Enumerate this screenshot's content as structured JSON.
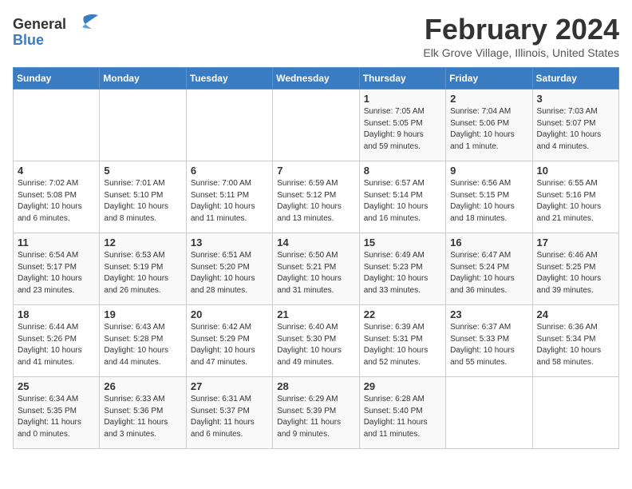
{
  "logo": {
    "general": "General",
    "blue": "Blue"
  },
  "title": "February 2024",
  "subtitle": "Elk Grove Village, Illinois, United States",
  "days_of_week": [
    "Sunday",
    "Monday",
    "Tuesday",
    "Wednesday",
    "Thursday",
    "Friday",
    "Saturday"
  ],
  "weeks": [
    [
      {
        "day": "",
        "info": ""
      },
      {
        "day": "",
        "info": ""
      },
      {
        "day": "",
        "info": ""
      },
      {
        "day": "",
        "info": ""
      },
      {
        "day": "1",
        "info": "Sunrise: 7:05 AM\nSunset: 5:05 PM\nDaylight: 9 hours\nand 59 minutes."
      },
      {
        "day": "2",
        "info": "Sunrise: 7:04 AM\nSunset: 5:06 PM\nDaylight: 10 hours\nand 1 minute."
      },
      {
        "day": "3",
        "info": "Sunrise: 7:03 AM\nSunset: 5:07 PM\nDaylight: 10 hours\nand 4 minutes."
      }
    ],
    [
      {
        "day": "4",
        "info": "Sunrise: 7:02 AM\nSunset: 5:08 PM\nDaylight: 10 hours\nand 6 minutes."
      },
      {
        "day": "5",
        "info": "Sunrise: 7:01 AM\nSunset: 5:10 PM\nDaylight: 10 hours\nand 8 minutes."
      },
      {
        "day": "6",
        "info": "Sunrise: 7:00 AM\nSunset: 5:11 PM\nDaylight: 10 hours\nand 11 minutes."
      },
      {
        "day": "7",
        "info": "Sunrise: 6:59 AM\nSunset: 5:12 PM\nDaylight: 10 hours\nand 13 minutes."
      },
      {
        "day": "8",
        "info": "Sunrise: 6:57 AM\nSunset: 5:14 PM\nDaylight: 10 hours\nand 16 minutes."
      },
      {
        "day": "9",
        "info": "Sunrise: 6:56 AM\nSunset: 5:15 PM\nDaylight: 10 hours\nand 18 minutes."
      },
      {
        "day": "10",
        "info": "Sunrise: 6:55 AM\nSunset: 5:16 PM\nDaylight: 10 hours\nand 21 minutes."
      }
    ],
    [
      {
        "day": "11",
        "info": "Sunrise: 6:54 AM\nSunset: 5:17 PM\nDaylight: 10 hours\nand 23 minutes."
      },
      {
        "day": "12",
        "info": "Sunrise: 6:53 AM\nSunset: 5:19 PM\nDaylight: 10 hours\nand 26 minutes."
      },
      {
        "day": "13",
        "info": "Sunrise: 6:51 AM\nSunset: 5:20 PM\nDaylight: 10 hours\nand 28 minutes."
      },
      {
        "day": "14",
        "info": "Sunrise: 6:50 AM\nSunset: 5:21 PM\nDaylight: 10 hours\nand 31 minutes."
      },
      {
        "day": "15",
        "info": "Sunrise: 6:49 AM\nSunset: 5:23 PM\nDaylight: 10 hours\nand 33 minutes."
      },
      {
        "day": "16",
        "info": "Sunrise: 6:47 AM\nSunset: 5:24 PM\nDaylight: 10 hours\nand 36 minutes."
      },
      {
        "day": "17",
        "info": "Sunrise: 6:46 AM\nSunset: 5:25 PM\nDaylight: 10 hours\nand 39 minutes."
      }
    ],
    [
      {
        "day": "18",
        "info": "Sunrise: 6:44 AM\nSunset: 5:26 PM\nDaylight: 10 hours\nand 41 minutes."
      },
      {
        "day": "19",
        "info": "Sunrise: 6:43 AM\nSunset: 5:28 PM\nDaylight: 10 hours\nand 44 minutes."
      },
      {
        "day": "20",
        "info": "Sunrise: 6:42 AM\nSunset: 5:29 PM\nDaylight: 10 hours\nand 47 minutes."
      },
      {
        "day": "21",
        "info": "Sunrise: 6:40 AM\nSunset: 5:30 PM\nDaylight: 10 hours\nand 49 minutes."
      },
      {
        "day": "22",
        "info": "Sunrise: 6:39 AM\nSunset: 5:31 PM\nDaylight: 10 hours\nand 52 minutes."
      },
      {
        "day": "23",
        "info": "Sunrise: 6:37 AM\nSunset: 5:33 PM\nDaylight: 10 hours\nand 55 minutes."
      },
      {
        "day": "24",
        "info": "Sunrise: 6:36 AM\nSunset: 5:34 PM\nDaylight: 10 hours\nand 58 minutes."
      }
    ],
    [
      {
        "day": "25",
        "info": "Sunrise: 6:34 AM\nSunset: 5:35 PM\nDaylight: 11 hours\nand 0 minutes."
      },
      {
        "day": "26",
        "info": "Sunrise: 6:33 AM\nSunset: 5:36 PM\nDaylight: 11 hours\nand 3 minutes."
      },
      {
        "day": "27",
        "info": "Sunrise: 6:31 AM\nSunset: 5:37 PM\nDaylight: 11 hours\nand 6 minutes."
      },
      {
        "day": "28",
        "info": "Sunrise: 6:29 AM\nSunset: 5:39 PM\nDaylight: 11 hours\nand 9 minutes."
      },
      {
        "day": "29",
        "info": "Sunrise: 6:28 AM\nSunset: 5:40 PM\nDaylight: 11 hours\nand 11 minutes."
      },
      {
        "day": "",
        "info": ""
      },
      {
        "day": "",
        "info": ""
      }
    ]
  ]
}
